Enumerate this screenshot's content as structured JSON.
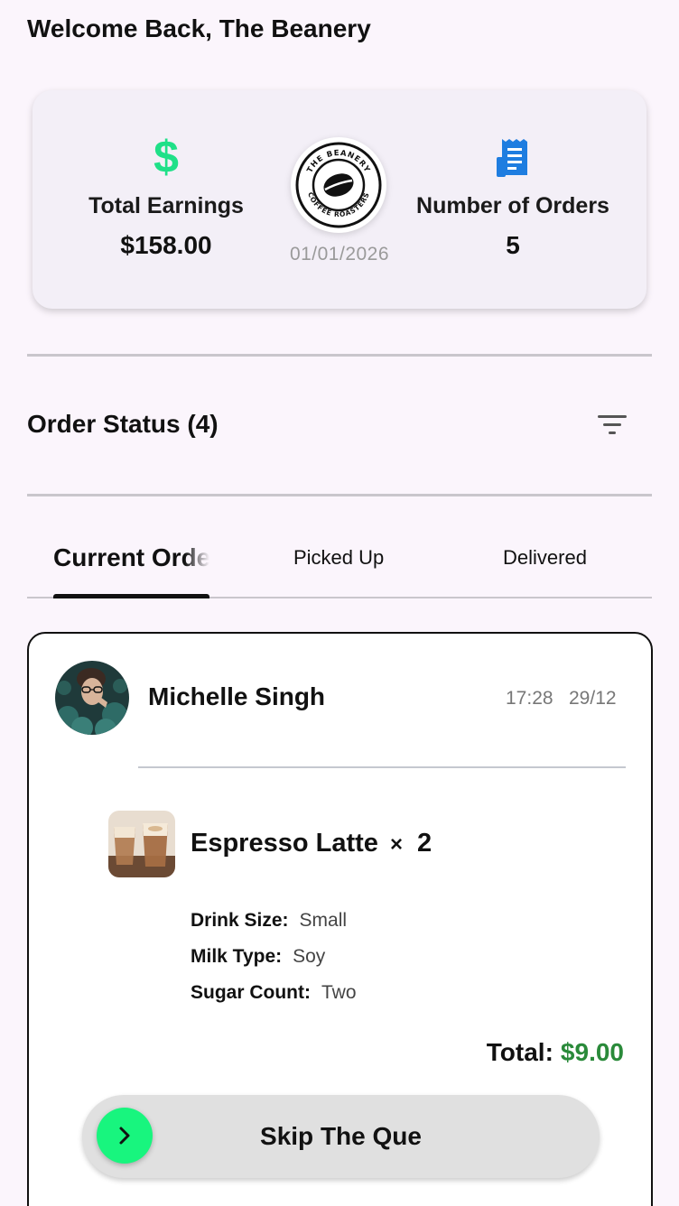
{
  "header": {
    "welcome": "Welcome Back, The Beanery"
  },
  "stats": {
    "earnings_label": "Total Earnings",
    "earnings_value": "$158.00",
    "dollar_icon": "$",
    "orders_label": "Number of Orders",
    "orders_value": "5",
    "date": "01/01/2026",
    "logo_text": "THE BEANERY · COFFEE ROASTERS"
  },
  "order_status": {
    "title": "Order Status (4)"
  },
  "tabs": [
    {
      "label": "Current Orders"
    },
    {
      "label": "Picked Up"
    },
    {
      "label": "Delivered"
    }
  ],
  "order": {
    "customer_name": "Michelle Singh",
    "time": "17:28",
    "date": "29/12",
    "item_name": "Espresso Latte",
    "times_symbol": "×",
    "quantity": "2",
    "options": [
      {
        "key": "Drink Size:",
        "value": "Small"
      },
      {
        "key": "Milk Type:",
        "value": "Soy"
      },
      {
        "key": "Sugar Count:",
        "value": "Two"
      }
    ],
    "total_label": "Total:",
    "total_value": "$9.00",
    "skip_label": "Skip The Que"
  },
  "colors": {
    "accent_green": "#1fe088",
    "knob_green": "#18f57e",
    "total_green": "#2a8a3a",
    "receipt_blue": "#1e7de0",
    "background": "#fbf5fc"
  },
  "icons": {
    "earnings": "dollar-icon",
    "orders": "receipt-icon",
    "filter": "filter-icon",
    "skip": "chevron-right-icon"
  }
}
